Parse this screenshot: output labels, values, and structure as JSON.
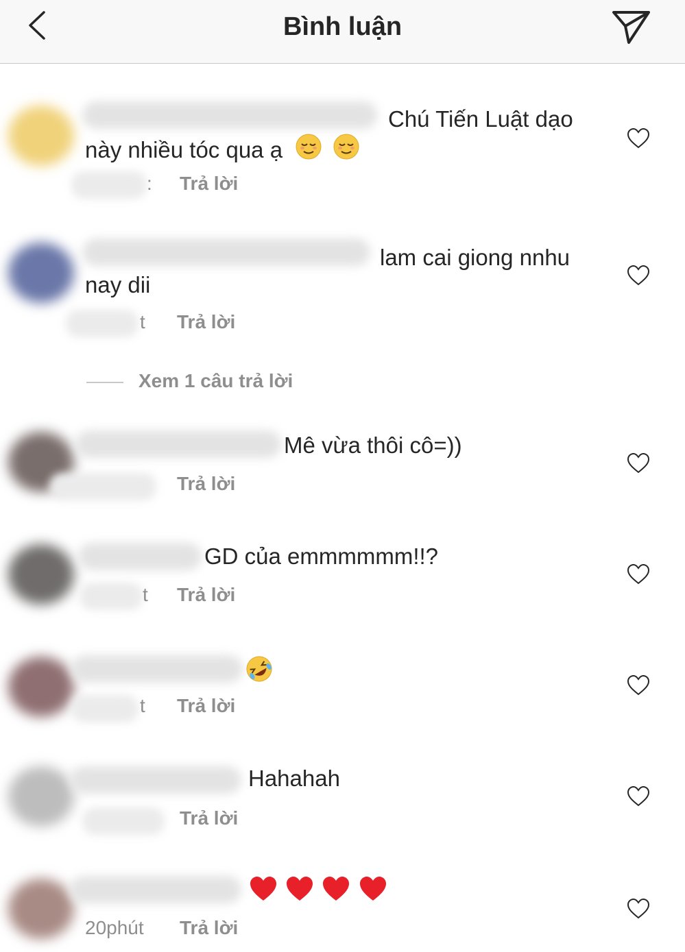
{
  "header": {
    "title": "Bình luận",
    "back_icon": "chevron-left-icon",
    "send_icon": "paper-plane-icon"
  },
  "comments": [
    {
      "line1": "Chú Tiến Luật dạo",
      "line2": "này nhiều tóc qua ạ",
      "emojis": "relieved-face x2",
      "time": ":",
      "reply": "Trả lời",
      "avatar_color": "#f0d27a"
    },
    {
      "line1": "lam cai giong nnhu",
      "line2": "nay dii",
      "time": "t",
      "reply": "Trả lời",
      "avatar_color": "#6a77a8"
    },
    {
      "line1": "Mê vừa thôi cô=))",
      "time": "",
      "reply": "Trả lời",
      "avatar_color": "#7a6e6c"
    },
    {
      "line1": "GD của emmmmmm!!?",
      "time": "t",
      "reply": "Trả lời",
      "avatar_color": "#6f6c6b"
    },
    {
      "line1": "",
      "emojis": "rolling-on-floor-laughing",
      "time": "t",
      "reply": "Trả lời",
      "avatar_color": "#8f6f72"
    },
    {
      "line1": "Hahahah",
      "time": "",
      "reply": "Trả lời",
      "avatar_color": "#bdbdbd"
    },
    {
      "line1": "",
      "emojis": "red-heart x4",
      "time": "20phút",
      "reply": "Trả lời",
      "avatar_color": "#a98b85"
    }
  ],
  "view_replies": "Xem 1 câu trả lời",
  "colors": {
    "text": "#262626",
    "secondary": "#8e8e8e",
    "header_bg": "#f8f8f8",
    "heart": "#e8202a"
  }
}
